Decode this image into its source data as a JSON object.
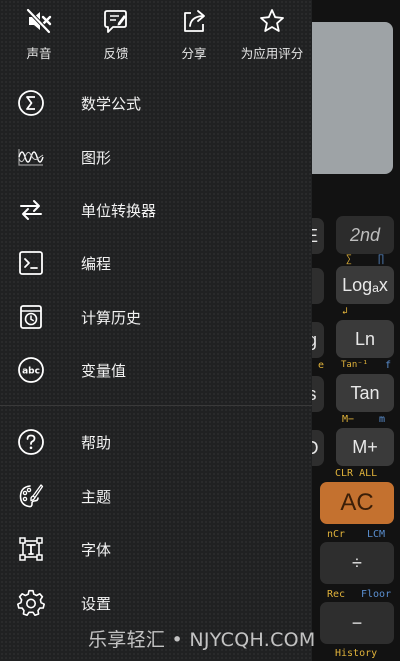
{
  "top_actions": [
    {
      "label": "声音",
      "icon": "speaker-muted-icon"
    },
    {
      "label": "反馈",
      "icon": "feedback-icon"
    },
    {
      "label": "分享",
      "icon": "share-icon"
    },
    {
      "label": "为应用评分",
      "icon": "star-icon"
    }
  ],
  "menu": [
    {
      "label": "数学公式",
      "icon": "sigma-icon"
    },
    {
      "label": "图形",
      "icon": "graph-wave-icon"
    },
    {
      "label": "单位转换器",
      "icon": "convert-arrows-icon"
    },
    {
      "label": "编程",
      "icon": "terminal-icon"
    },
    {
      "label": "计算历史",
      "icon": "history-clock-icon"
    },
    {
      "label": "变量值",
      "icon": "abc-icon"
    },
    {
      "label": "帮助",
      "icon": "help-icon"
    },
    {
      "label": "主题",
      "icon": "palette-icon"
    },
    {
      "label": "字体",
      "icon": "font-icon"
    },
    {
      "label": "设置",
      "icon": "settings-icon"
    }
  ],
  "calculator_background": {
    "keys": {
      "e_partial": "E",
      "second": "2nd",
      "log_a_x": "Logₐx",
      "ln": "Ln",
      "g_partial": "g",
      "tan": "Tan",
      "s_partial": "s",
      "m_plus": "M+",
      "d_partial": "D",
      "ac": "AC",
      "divide": "÷",
      "minus": "−"
    },
    "sub_labels": {
      "sum": "∑",
      "pi": "∏",
      "tan_inv": "Tan⁻¹",
      "e": "e",
      "f": "f",
      "m_minus": "M−",
      "m": "m",
      "clr_all": "CLR ALL",
      "ncr": "nCr",
      "lcm": "LCM",
      "rec": "Rec",
      "floor": "Floor",
      "history": "History"
    },
    "colors": {
      "ac_key": "#c4712f",
      "yellow_label": "#e0b23a",
      "blue_label": "#5a8fd0"
    }
  },
  "watermark": "乐享轻汇 • NJYCQH.COM"
}
